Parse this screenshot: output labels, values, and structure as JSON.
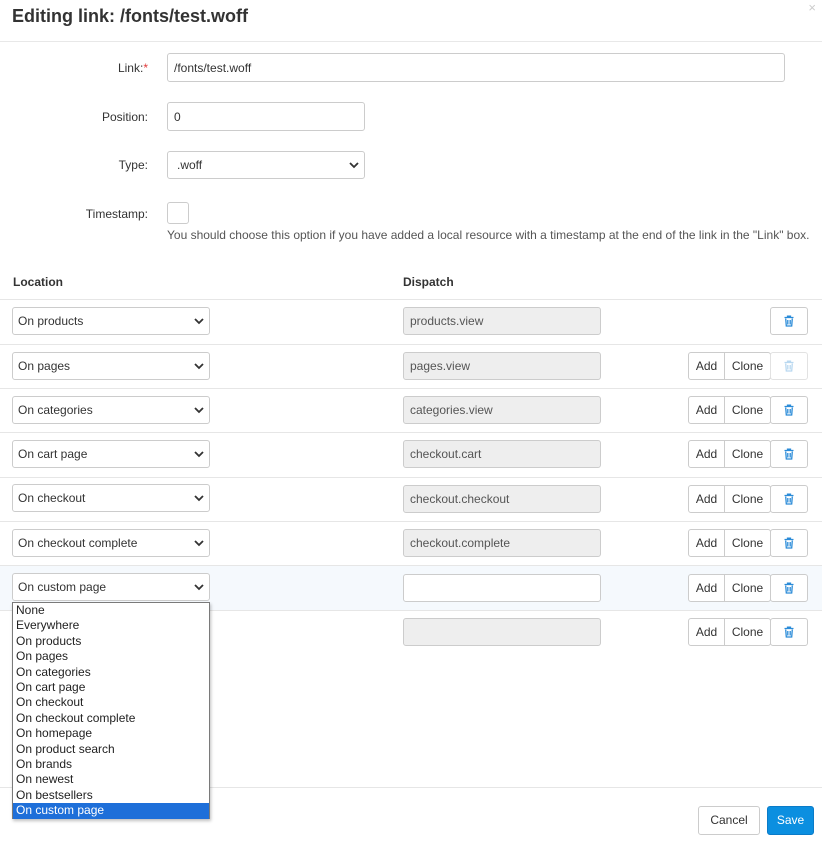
{
  "dialog": {
    "title": "Editing link: /fonts/test.woff",
    "close_glyph": "×"
  },
  "form": {
    "link_label": "Link:",
    "required_mark": "*",
    "link_value": "/fonts/test.woff",
    "position_label": "Position:",
    "position_value": "0",
    "type_label": "Type:",
    "type_value": ".woff",
    "timestamp_label": "Timestamp:",
    "timestamp_checked": false,
    "timestamp_help": "You should choose this option if you have added a local resource with a timestamp at the end of the link in the \"Link\" box."
  },
  "table": {
    "col_location": "Location",
    "col_dispatch": "Dispatch",
    "add_label": "Add",
    "clone_label": "Clone",
    "rows": [
      {
        "location": "On products",
        "dispatch": "products.view"
      },
      {
        "location": "On pages",
        "dispatch": "pages.view"
      },
      {
        "location": "On categories",
        "dispatch": "categories.view"
      },
      {
        "location": "On cart page",
        "dispatch": "checkout.cart"
      },
      {
        "location": "On checkout",
        "dispatch": "checkout.checkout"
      },
      {
        "location": "On checkout complete",
        "dispatch": "checkout.complete"
      },
      {
        "location": "On custom page",
        "dispatch": ""
      },
      {
        "location": "",
        "dispatch": ""
      }
    ]
  },
  "location_options": [
    "None",
    "Everywhere",
    "On products",
    "On pages",
    "On categories",
    "On cart page",
    "On checkout",
    "On checkout complete",
    "On homepage",
    "On product search",
    "On brands",
    "On newest",
    "On bestsellers",
    "On custom page"
  ],
  "location_selected": "On custom page",
  "footer": {
    "cancel_label": "Cancel",
    "save_label": "Save"
  },
  "colors": {
    "primary": "#0b8fe0",
    "selected_option": "#1e6fd9",
    "delete_icon": "#2a8bd8",
    "required": "#e13b3b"
  }
}
